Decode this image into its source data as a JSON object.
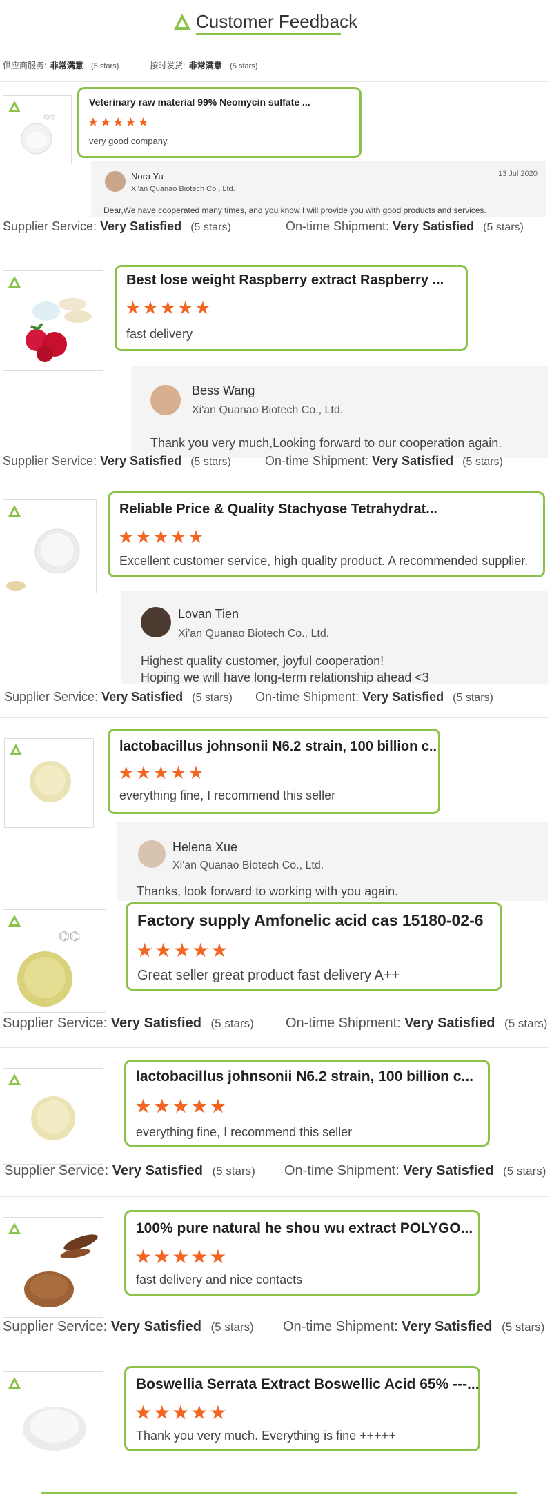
{
  "page": {
    "title": "Customer Feedback",
    "accent": "#8bc34a",
    "star_color": "#f26522"
  },
  "summary": {
    "supplier_label": "供应商服务:",
    "supplier_value": "非常满意",
    "supplier_stars": "(5 stars)",
    "shipment_label": "按时发货:",
    "shipment_value": "非常满意",
    "shipment_stars": "(5 stars)"
  },
  "ratings": {
    "supplier_label": "Supplier Service:",
    "shipment_label": "On-time Shipment:",
    "value": "Very Satisfied",
    "stars": "(5 stars)"
  },
  "reviews": [
    {
      "product": "Veterinary raw material 99% Neomycin sulfate ...",
      "stars": "★★★★★",
      "comment": "very good company.",
      "reply": {
        "name": "Nora Yu",
        "company": "Xi'an Quanao Biotech Co., Ltd.",
        "date": "13 Jul 2020",
        "text": "Dear,We have cooperated many times, and you know I will provide you with good products and services."
      }
    },
    {
      "product": "Best lose weight Raspberry extract Raspberry ...",
      "stars": "★★★★★",
      "comment": "fast delivery",
      "reply": {
        "name": "Bess Wang",
        "company": "Xi'an Quanao Biotech Co., Ltd.",
        "text": "Thank you very much,Looking forward to our cooperation again."
      }
    },
    {
      "product": "Reliable Price & Quality Stachyose Tetrahydrat...",
      "stars": "★★★★★",
      "comment": "Excellent customer service, high quality product. A recommended supplier.",
      "reply": {
        "name": "Lovan Tien",
        "company": "Xi'an Quanao Biotech Co., Ltd.",
        "text1": "Highest quality customer, joyful cooperation!",
        "text2": "Hoping we will have long-term relationship ahead <3"
      }
    },
    {
      "product": "lactobacillus johnsonii N6.2 strain, 100 billion c...",
      "stars": "★★★★★",
      "comment": "everything fine, I recommend this seller",
      "reply": {
        "name": "Helena Xue",
        "company": "Xi'an Quanao Biotech Co., Ltd.",
        "text": "Thanks, look forward to working with you  again."
      }
    },
    {
      "product": "Factory supply Amfonelic acid cas 15180-02-6",
      "stars": "★★★★★",
      "comment": "Great seller great product fast delivery A++"
    },
    {
      "product": "lactobacillus johnsonii N6.2 strain, 100 billion c...",
      "stars": "★★★★★",
      "comment": "everything fine, I recommend this seller"
    },
    {
      "product": "100% pure natural he shou wu extract POLYGO...",
      "stars": "★★★★★",
      "comment": "fast delivery and nice contacts"
    },
    {
      "product": "Boswellia Serrata Extract Boswellic Acid 65% ---...",
      "stars": "★★★★★",
      "comment": "Thank you very much. Everything is fine +++++"
    }
  ]
}
